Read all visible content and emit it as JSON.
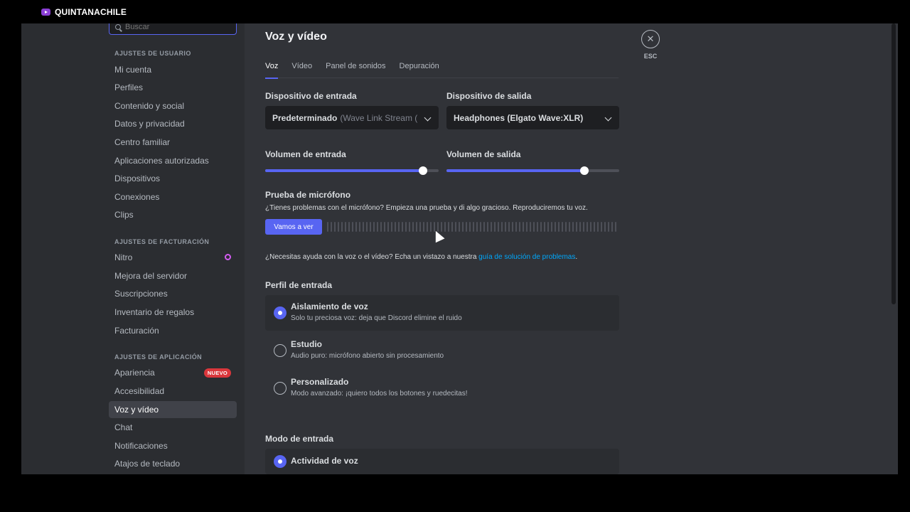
{
  "overlay": {
    "channel_name": "QUINTANACHILE"
  },
  "sidebar": {
    "search_placeholder": "Buscar",
    "sections": [
      {
        "header": "Ajustes de usuario",
        "items": [
          "Mi cuenta",
          "Perfiles",
          "Contenido y social",
          "Datos y privacidad",
          "Centro familiar",
          "Aplicaciones autorizadas",
          "Dispositivos",
          "Conexiones",
          "Clips"
        ]
      },
      {
        "header": "Ajustes de facturación",
        "items": [
          "Nitro",
          "Mejora del servidor",
          "Suscripciones",
          "Inventario de regalos",
          "Facturación"
        ]
      },
      {
        "header": "Ajustes de aplicación",
        "items": [
          "Apariencia",
          "Accesibilidad",
          "Voz y vídeo",
          "Chat",
          "Notificaciones",
          "Atajos de teclado"
        ]
      }
    ],
    "badge_new": "NUEVO",
    "active_item": "Voz y vídeo"
  },
  "main": {
    "title": "Voz y vídeo",
    "close_label": "ESC",
    "tabs": [
      {
        "label": "Voz",
        "active": true
      },
      {
        "label": "Vídeo",
        "active": false
      },
      {
        "label": "Panel de sonidos",
        "active": false
      },
      {
        "label": "Depuración",
        "active": false
      }
    ],
    "input_device": {
      "label": "Dispositivo de entrada",
      "value": "Predeterminado",
      "detail": "(Wave Link Stream (Elgato Wave:XLR))"
    },
    "output_device": {
      "label": "Dispositivo de salida",
      "value": "Headphones (Elgato Wave:XLR)"
    },
    "input_volume": {
      "label": "Volumen de entrada",
      "level": 0.91
    },
    "output_volume": {
      "label": "Volumen de salida",
      "level": 0.8
    },
    "mic_test": {
      "title": "Prueba de micrófono",
      "description": "¿Tienes problemas con el micrófono? Empieza una prueba y di algo gracioso. Reproduciremos tu voz.",
      "button": "Vamos a ver"
    },
    "help": {
      "text": "¿Necesitas ayuda con la voz o el vídeo? Echa un vistazo a nuestra ",
      "link": "guía de solución de problemas",
      "suffix": "."
    },
    "input_profile": {
      "title": "Perfil de entrada",
      "options": [
        {
          "title": "Aislamiento de voz",
          "subtitle": "Solo tu preciosa voz: deja que Discord elimine el ruido",
          "selected": true
        },
        {
          "title": "Estudio",
          "subtitle": "Audio puro: micrófono abierto sin procesamiento",
          "selected": false
        },
        {
          "title": "Personalizado",
          "subtitle": "Modo avanzado: ¡quiero todos los botones y ruedecitas!",
          "selected": false
        }
      ]
    },
    "input_mode": {
      "title": "Modo de entrada",
      "options": [
        {
          "title": "Actividad de voz",
          "selected": true
        }
      ]
    }
  },
  "colors": {
    "accent": "#5865f2",
    "badge": "#da373c",
    "link": "#00a8fc",
    "nitro": "#d35cf0"
  }
}
